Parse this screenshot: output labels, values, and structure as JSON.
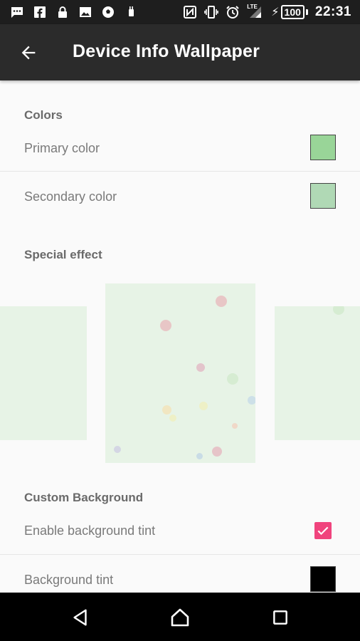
{
  "status_bar": {
    "icons_left": [
      "chat-icon",
      "facebook-icon",
      "lock-icon",
      "image-icon",
      "soccer-ball-icon",
      "power-icon"
    ],
    "icons_right": [
      "nfc-icon",
      "vibrate-icon",
      "alarm-icon",
      "signal-icon"
    ],
    "network_label": "LTE",
    "battery": "100",
    "time": "22:31"
  },
  "app_bar": {
    "title": "Device Info Wallpaper"
  },
  "sections": {
    "colors_header": "Colors",
    "primary_label": "Primary color",
    "primary_color": "#99d598",
    "secondary_label": "Secondary color",
    "secondary_color": "#b0d9b5",
    "special_effect_header": "Special effect",
    "custom_background_header": "Custom Background",
    "enable_tint_label": "Enable background tint",
    "enable_tint_checked": true,
    "background_tint_label": "Background tint",
    "tint_color": "#000000"
  },
  "colors": {
    "accent": "#f0437d",
    "app_bar_bg": "#2b2b2b",
    "card_bg": "#e7f3e6"
  }
}
